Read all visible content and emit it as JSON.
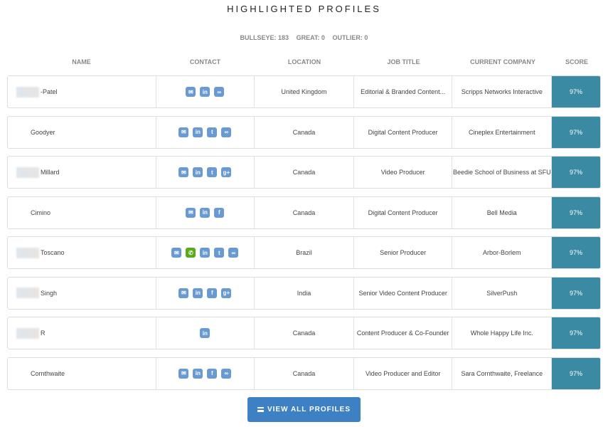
{
  "title": "HIGHLIGHTED PROFILES",
  "stats": {
    "bullseye": "BULLSEYE: 183",
    "great": "GREAT: 0",
    "outlier": "OUTLIER: 0"
  },
  "columns": [
    "NAME",
    "CONTACT",
    "LOCATION",
    "JOB TITLE",
    "CURRENT COMPANY",
    "SCORE"
  ],
  "rows": [
    {
      "name": "-Patel",
      "blurred": true,
      "contact": [
        "email",
        "linkedin",
        "link"
      ],
      "location": "United Kingdom",
      "job": "Editorial & Branded Content...",
      "company": "Scripps Networks Interactive",
      "score": "97%"
    },
    {
      "name": "Goodyer",
      "blurred": false,
      "contact": [
        "email",
        "linkedin",
        "twitter",
        "link"
      ],
      "location": "Canada",
      "job": "Digital Content Producer",
      "company": "Cineplex Entertainment",
      "score": "97%"
    },
    {
      "name": "Millard",
      "blurred": true,
      "contact": [
        "email",
        "linkedin",
        "twitter",
        "google-plus"
      ],
      "location": "Canada",
      "job": "Video Producer",
      "company": "Beedie School of Business at SFU",
      "score": "97%"
    },
    {
      "name": "Cimino",
      "blurred": false,
      "contact": [
        "email",
        "linkedin",
        "facebook"
      ],
      "location": "Canada",
      "job": "Digital Content Producer",
      "company": "Bell Media",
      "score": "97%"
    },
    {
      "name": "Toscano",
      "blurred": true,
      "contact": [
        "email",
        "phone",
        "linkedin",
        "twitter",
        "link"
      ],
      "location": "Brazil",
      "job": "Senior Producer",
      "company": "Arbor-Borlem",
      "score": "97%"
    },
    {
      "name": "Singh",
      "blurred": true,
      "contact": [
        "email",
        "linkedin",
        "facebook",
        "google-plus"
      ],
      "location": "India",
      "job": "Senior Video Content Producer",
      "company": "SilverPush",
      "score": "97%"
    },
    {
      "name": "R",
      "blurred": true,
      "contact": [
        "linkedin"
      ],
      "location": "Canada",
      "job": "Content Producer & Co-Founder",
      "company": "Whole Happy Life Inc.",
      "score": "97%"
    },
    {
      "name": "Cornthwaite",
      "blurred": false,
      "contact": [
        "email",
        "linkedin",
        "facebook",
        "link"
      ],
      "location": "Canada",
      "job": "Video Producer and Editor",
      "company": "Sara Cornthwaite, Freelance",
      "score": "97%"
    }
  ],
  "button": "VIEW ALL PROFILES",
  "colors": {
    "score_bg": "#3a8aa3",
    "button": "#3d80c4",
    "email": "#d63a3a",
    "phone": "#5aaa1a",
    "social": "#6a9ad3"
  }
}
